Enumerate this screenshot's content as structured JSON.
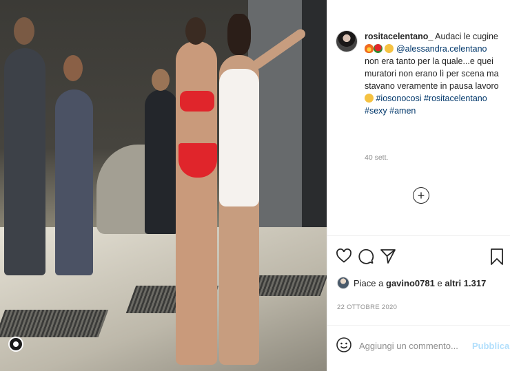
{
  "post": {
    "username": "rositacelentano_",
    "caption_part1": "Audaci le cugine",
    "emoji_fire": "fire-emoji",
    "emoji_rose": "rose-emoji",
    "emoji_laugh": "laughing-emoji",
    "mention": "@alessandra.celentano",
    "caption_part2": "non era tanto per la quale...e quei muratori non erano lì per scena ma stavano veramente in pausa lavoro",
    "emoji_wink": "winking-emoji",
    "hashtags": [
      "#iosonocosi",
      "#rositacelentano",
      "#sexy",
      "#amen"
    ],
    "time_ago": "40 sett.",
    "load_more_symbol": "+"
  },
  "likes": {
    "prefix": "Piace a ",
    "user": "gavino0781",
    "middle": " e ",
    "others": "altri 1.317"
  },
  "date": "22 OTTOBRE 2020",
  "comment": {
    "placeholder": "Aggiungi un commento...",
    "publish_label": "Pubblica"
  },
  "icons": {
    "like": "heart-icon",
    "comment": "comment-icon",
    "share": "send-icon",
    "save": "bookmark-icon",
    "emoji": "smiley-icon",
    "load_more": "plus-circle-icon"
  },
  "colors": {
    "link": "#00376b",
    "muted": "#8e8e8e",
    "publish": "#b2dffc",
    "text": "#262626"
  }
}
